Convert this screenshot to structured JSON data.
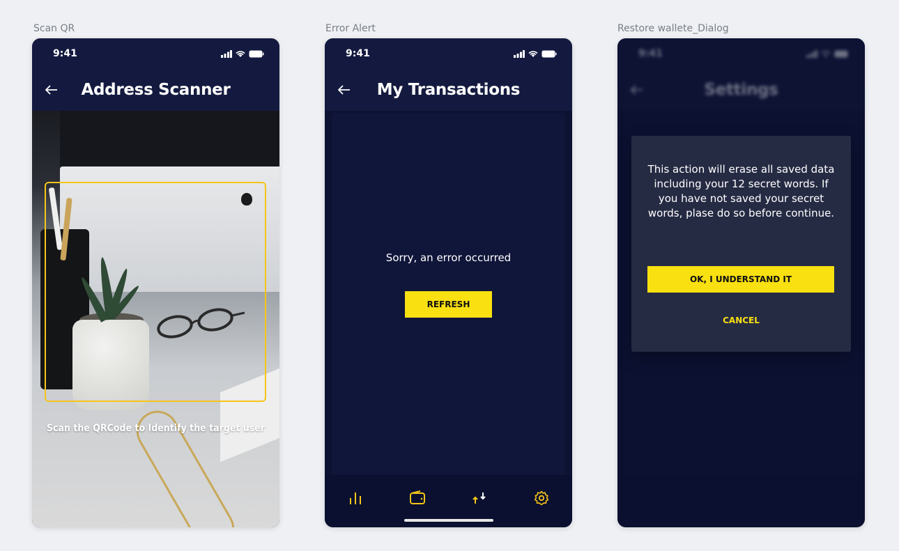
{
  "frames": [
    {
      "label": "Scan QR",
      "time": "9:41",
      "title": "Address Scanner",
      "hint": "Scan the QRCode to Identify the target user"
    },
    {
      "label": "Error Alert",
      "time": "9:41",
      "title": "My Transactions",
      "error_message": "Sorry, an error occurred",
      "refresh_label": "REFRESH",
      "nav": [
        "chart-icon",
        "wallet-icon",
        "transfer-icon",
        "settings-icon"
      ]
    },
    {
      "label": "Restore wallete_Dialog",
      "time": "9:41",
      "title": "Settings",
      "dialog_message": "This action will erase all saved data including your 12 secret words. If you have not saved your secret words, plase do so before continue.",
      "confirm_label": "OK, I UNDERSTAND IT",
      "cancel_label": "CANCEL"
    }
  ],
  "colors": {
    "accent": "#f9e010",
    "background": "#0d1233",
    "appbar": "#141a3f",
    "frame_border": "#f5c518"
  }
}
